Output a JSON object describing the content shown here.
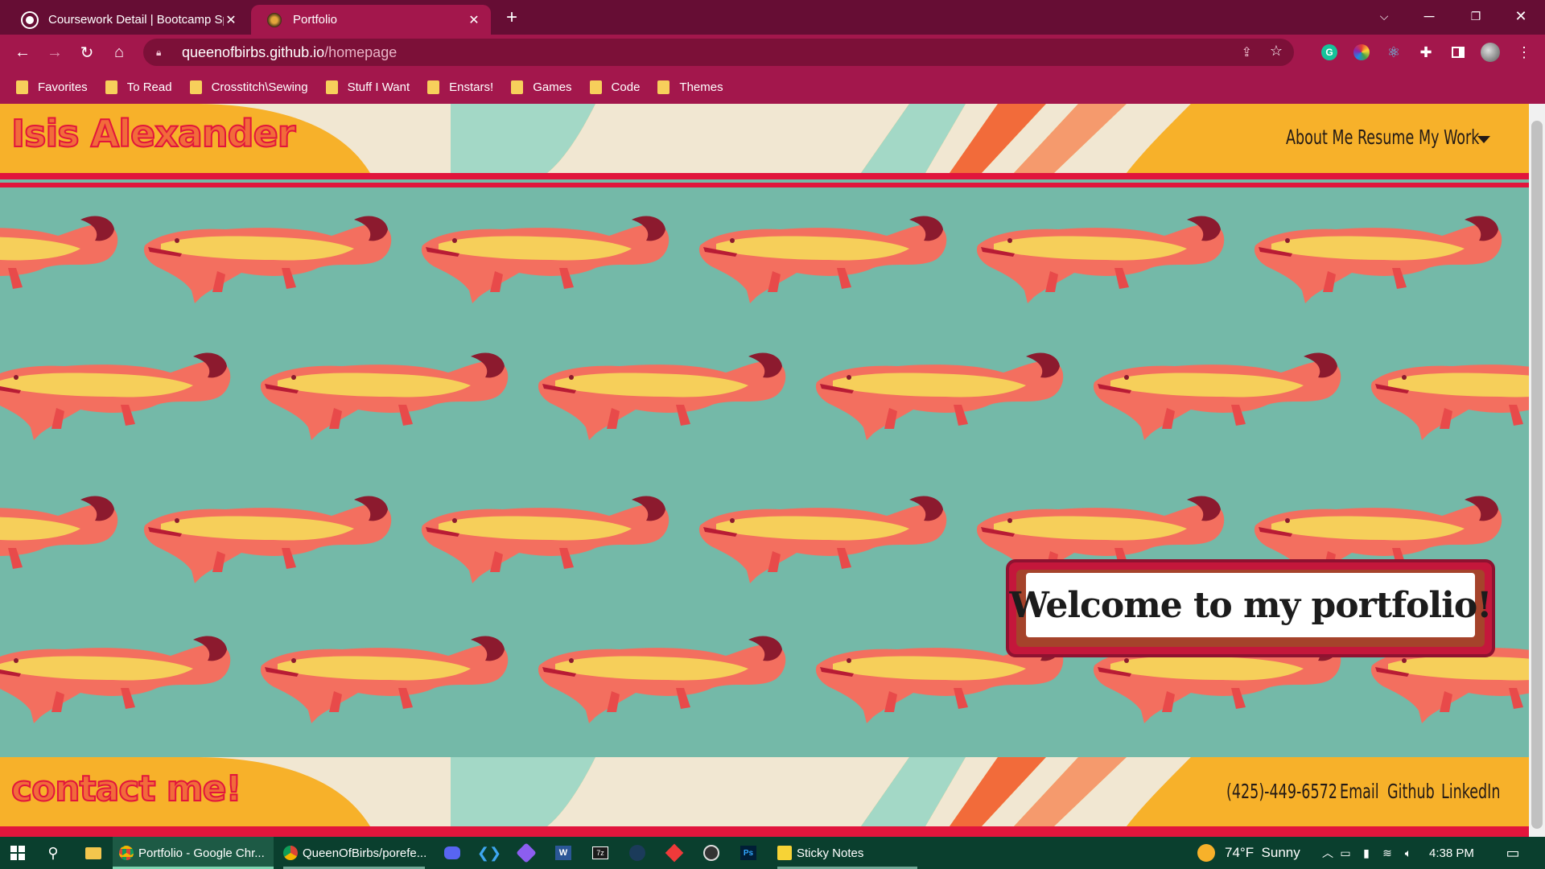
{
  "browser": {
    "tabs": [
      {
        "title": "Coursework Detail | Bootcamp Sp",
        "active": false
      },
      {
        "title": "Portfolio",
        "active": true
      }
    ],
    "new_tab_label": "+",
    "url_host": "queenofbirbs.github.io",
    "url_path": "/homepage",
    "bookmarks": [
      "Favorites",
      "To Read",
      "Crosstitch\\Sewing",
      "Stuff I Want",
      "Enstars!",
      "Games",
      "Code",
      "Themes"
    ]
  },
  "site": {
    "logo": "Isis Alexander",
    "nav": {
      "about": "About Me",
      "resume": "Resume",
      "work": "My Work"
    },
    "welcome": "Welcome to my portfolio!",
    "footer": {
      "contact": "contact me!",
      "phone": "(425)-449-6572",
      "email": "Email",
      "github": "Github",
      "linkedin": "LinkedIn"
    }
  },
  "taskbar": {
    "apps": [
      {
        "label": "Portfolio - Google Chr...",
        "active": true
      },
      {
        "label": "QueenOfBirbs/porefe...",
        "active": false
      },
      {
        "label": "Sticky Notes",
        "active": false
      }
    ],
    "weather": "74°F  Sunny",
    "time": "4:38 PM"
  },
  "colors": {
    "chrome_dark": "#660d34",
    "chrome": "#a3174c",
    "teal": "#74b9a8",
    "mustard": "#f7b12a",
    "red": "#e1153c",
    "gator": "#f2665a",
    "taskbar": "#0a3f2e"
  }
}
